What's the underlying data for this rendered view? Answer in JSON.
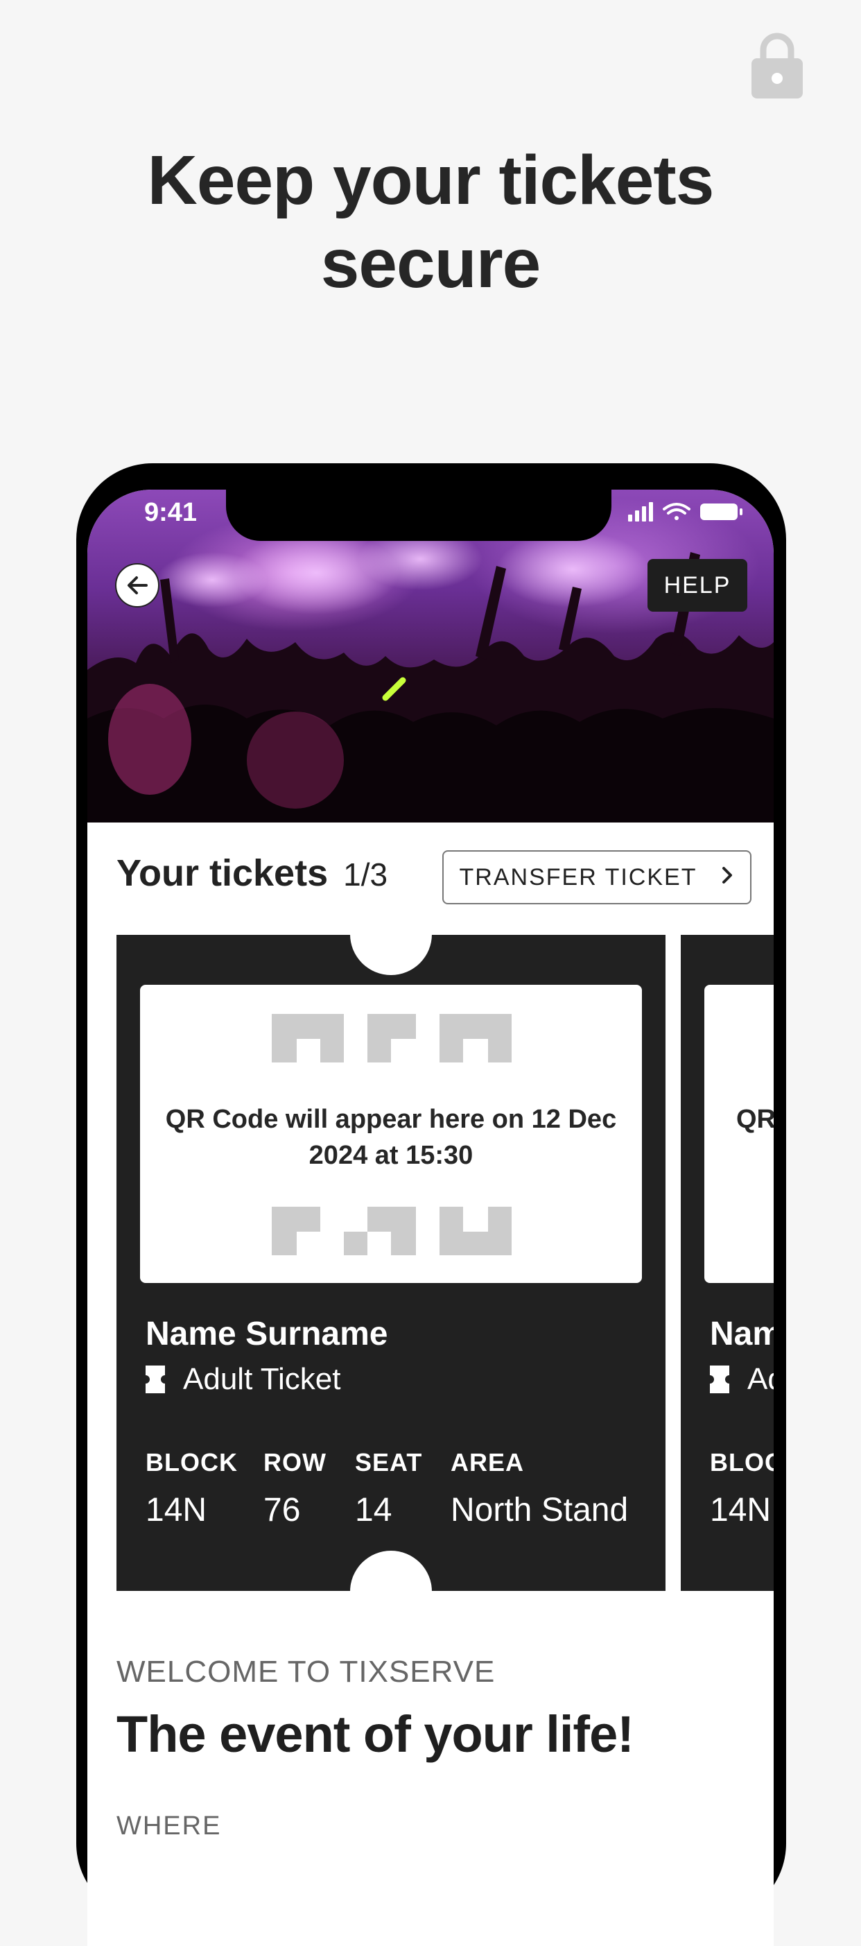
{
  "headline": {
    "line1": "Keep your tickets",
    "line2": "secure"
  },
  "status_bar": {
    "time": "9:41"
  },
  "hero": {
    "help_label": "HELP"
  },
  "tickets_section": {
    "title": "Your tickets",
    "count": "1/3",
    "transfer_label": "TRANSFER TICKET"
  },
  "tickets": [
    {
      "qr_text": "QR Code will appear here on 12 Dec 2024 at 15:30",
      "name": "Name Surname",
      "type": "Adult Ticket",
      "block_label": "BLOCK",
      "block": "14N",
      "row_label": "ROW",
      "row": "76",
      "seat_label": "SEAT",
      "seat": "14",
      "area_label": "AREA",
      "area": "North Stand"
    },
    {
      "qr_text": "QR",
      "name": "Nam",
      "type": "Ad",
      "block_label": "BLOC",
      "block": "14N"
    }
  ],
  "event": {
    "welcome": "WELCOME TO TIXSERVE",
    "title": "The event of your life!",
    "where_label": "WHERE"
  },
  "colors": {
    "ticket_bg": "#212121",
    "qr_block": "#cccccc",
    "hero_purple": "#8d49b8"
  }
}
